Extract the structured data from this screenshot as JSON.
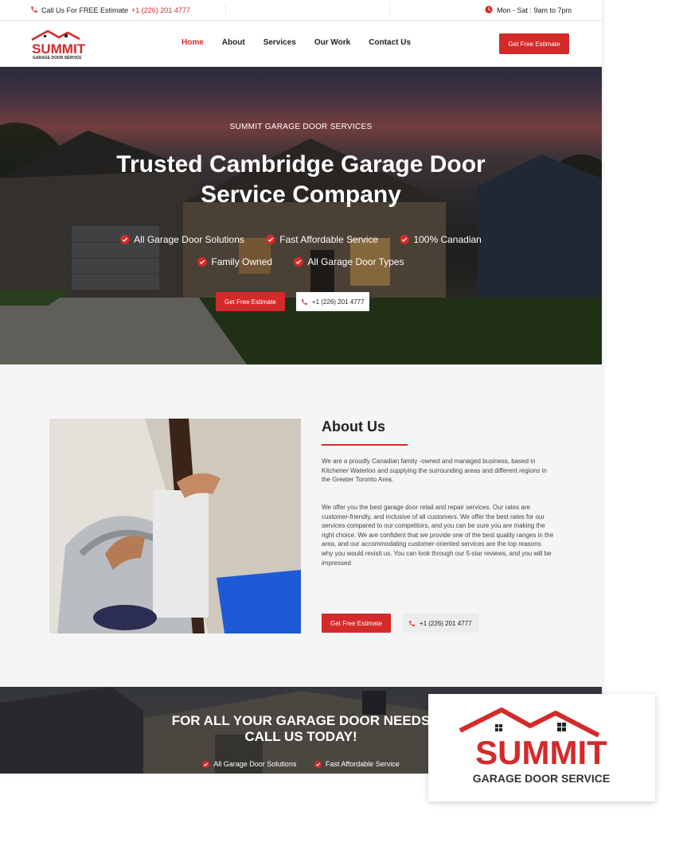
{
  "topbar": {
    "call_prefix": "Call Us For FREE Estimate",
    "phone": "+1 (226) 201 4777",
    "hours": "Mon - Sat : 9am to 7pm"
  },
  "brand": {
    "name": "SUMMIT",
    "tagline": "GARAGE DOOR SERVICE",
    "accent_color": "#d42a2a"
  },
  "nav": {
    "items": [
      {
        "label": "Home",
        "active": true
      },
      {
        "label": "About"
      },
      {
        "label": "Services"
      },
      {
        "label": "Our Work"
      },
      {
        "label": "Contact Us"
      }
    ],
    "cta": "Get Free Estimate"
  },
  "hero": {
    "kicker": "SUMMIT GARAGE DOOR SERVICES",
    "title": "Trusted Cambridge Garage Door Service Company",
    "features": [
      "All Garage Door Solutions",
      "Fast Affordable Service",
      "100% Canadian",
      "Family Owned",
      "All Garage Door Types"
    ],
    "btn_estimate": "Get Free Estimate",
    "btn_phone": "+1 (226) 201 4777"
  },
  "about": {
    "title": "About Us",
    "para1": "We are a proudly Canadian family -owned and managed business, based in Kitchener Waterloo and supplying the surrounding areas and different regions in the Greater Toronto Area.",
    "para2": "We offer you the best garage door retail and repair services. Our rates are customer-friendly, and inclusive of all customers. We offer the best rates for our services compared to our competitors, and you can be sure you are making the right choice. We are confident that we provide one of the best quality ranges in the area, and our accommodating customer-oriented services are the top reasons why you would revisit us. You can look through our 5-star reviews, and you will be impressed",
    "btn_estimate": "Get Free Estimate",
    "btn_phone": "+1 (226) 201 4777"
  },
  "cta": {
    "title_line1": "FOR ALL YOUR GARAGE DOOR NEEDS",
    "title_line2": "CALL US TODAY!",
    "features": [
      "All Garage Door Solutions",
      "Fast Affordable Service"
    ]
  }
}
